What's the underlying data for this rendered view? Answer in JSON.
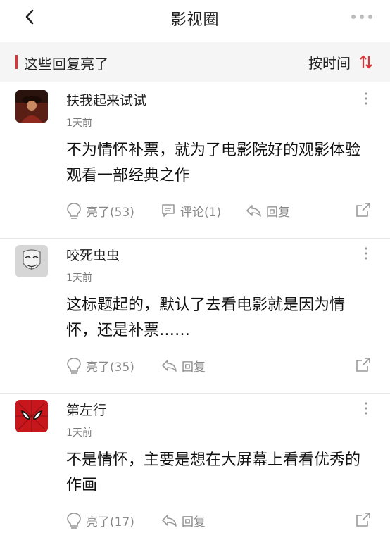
{
  "header": {
    "title": "影视圈"
  },
  "section": {
    "title": "这些回复亮了",
    "sort_label": "按时间"
  },
  "comments": [
    {
      "username": "扶我起来试试",
      "time": "1天前",
      "content": "不为情怀补票，就为了电影院好的观影体验观看一部经典之作",
      "like_label": "亮了(53)",
      "comment_label": "评论(1)",
      "reply_label": "回复",
      "avatar": "person-red-photo-avatar"
    },
    {
      "username": "咬死虫虫",
      "time": "1天前",
      "content": "这标题起的，默认了去看电影就是因为情怀，还是补票……",
      "like_label": "亮了(35)",
      "reply_label": "回复",
      "avatar": "mask-avatar"
    },
    {
      "username": "第左行",
      "time": "1天前",
      "content": "不是情怀，主要是想在大屏幕上看看优秀的作画",
      "like_label": "亮了(17)",
      "reply_label": "回复",
      "avatar": "spiderman-avatar"
    }
  ],
  "colors": {
    "accent": "#d9363a",
    "section_bg": "#f5f5f5",
    "muted": "#888888"
  }
}
